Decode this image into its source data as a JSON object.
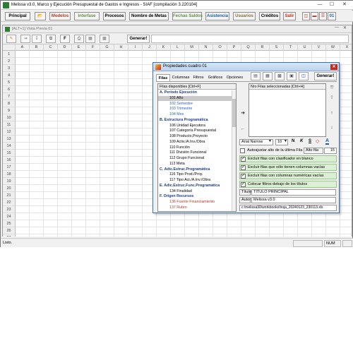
{
  "window": {
    "title": "Melissa v3.0, Marco y Ejecución Presupuestal de Gastos e Ingresos - SIAF  [compilación 3.220104]"
  },
  "menu": {
    "principal": "Principal",
    "modelos": "Modelos",
    "interfase": "Interfase",
    "procesos": "Procesos",
    "nombre_metas": "Nombre de Metas",
    "fechas_saldos": "Fechas Saldos",
    "asistencia": "Asistencia",
    "usuarios": "Usuarios",
    "creditos": "Créditos",
    "salir": "Salir",
    "counter": "01"
  },
  "inner": {
    "title": "[ALT+1] Vista Previa 01",
    "bold_label": "F",
    "generar_label": "Generar!"
  },
  "grid": {
    "columns": [
      "A",
      "B",
      "C",
      "D",
      "E",
      "F",
      "G",
      "H",
      "I",
      "J",
      "K",
      "L",
      "M",
      "N",
      "O",
      "P",
      "Q",
      "R",
      "S",
      "T",
      "U",
      "V",
      "W",
      "X"
    ],
    "rows": [
      "1",
      "2",
      "3",
      "4",
      "5",
      "6",
      "7",
      "8",
      "9",
      "10",
      "11",
      "12",
      "13",
      "14",
      "15",
      "16",
      "17",
      "18",
      "19",
      "20",
      "21",
      "22",
      "23",
      "24",
      "25",
      "26",
      "27"
    ]
  },
  "dialog": {
    "title": "Propiedades cuadro 01",
    "tabs": [
      "Filas",
      "Columnas",
      "Filtros",
      "Gráficos",
      "Opciones"
    ],
    "generar_label": "Generar!",
    "available_header": "Filas disponibles     [Ctrl+F]",
    "selected_header": "Nro  Filas seleccionadas     [Ctrl+H]",
    "available_rows": [
      {
        "text": "A. Período Ejecución",
        "style": "grp"
      },
      {
        "text": "101 Año",
        "style": "sel"
      },
      {
        "text": "102 Semestre",
        "style": "blue"
      },
      {
        "text": "103 Trimestre",
        "style": "blue"
      },
      {
        "text": "104 Mes",
        "style": "blue"
      },
      {
        "text": "B. Estructura Programática",
        "style": "grp"
      },
      {
        "text": "106 Unidad Ejecutora",
        "style": ""
      },
      {
        "text": "107 Categoría Presupuestal",
        "style": ""
      },
      {
        "text": "108 Producto,Proyecto",
        "style": ""
      },
      {
        "text": "109 Activ./A.Inv./Obra",
        "style": ""
      },
      {
        "text": "110 Función",
        "style": ""
      },
      {
        "text": "111 División Funcional",
        "style": ""
      },
      {
        "text": "112 Grupo Funcional",
        "style": ""
      },
      {
        "text": "113 Meta",
        "style": ""
      },
      {
        "text": "C. Adic.Estruc.Programática",
        "style": "grp"
      },
      {
        "text": "116 Tipo Prod./Proy.",
        "style": ""
      },
      {
        "text": "117 Tipo Act./A.Inv./Obra",
        "style": ""
      },
      {
        "text": "E. Adic.Estruc.Func.Programática",
        "style": "grp"
      },
      {
        "text": "134 Finalidad",
        "style": ""
      },
      {
        "text": "F. Origen Recursos",
        "style": "grp"
      },
      {
        "text": "136 Fuente Financiamiento",
        "style": "red"
      },
      {
        "text": "137 Rubro",
        "style": "red"
      }
    ],
    "font_name": "Arial Narrow",
    "font_size": "10",
    "format_bold": "N",
    "format_italic": "K",
    "format_underline": "S",
    "autoajustar": "Autoajustar alto de la última Fila",
    "alto_fila_label": "Alto fila",
    "alto_fila_value": "15",
    "options": [
      "Excluir filas con clasificador en blanco",
      "Excluir filas que sólo tienen columnas vacías",
      "Excluir filas con columnas numéricas vacías",
      "Colocar filtros debajo de los títulos"
    ],
    "titulo_label": "Título",
    "titulo_value": "TÍTULO PRINCIPAL",
    "autor_label": "Autor",
    "autor_value": "Melissa v3.0",
    "path_value": "c:\\melissa30\\workbooks\\hoja_20240123_230113.xls"
  },
  "status": {
    "left": "Listo.",
    "num": "NUM"
  },
  "colors": {
    "accent": "#3c6fb4",
    "group_text": "#1f3d8a",
    "green_option": "#dcefd6",
    "close_red": "#c42b1c"
  }
}
